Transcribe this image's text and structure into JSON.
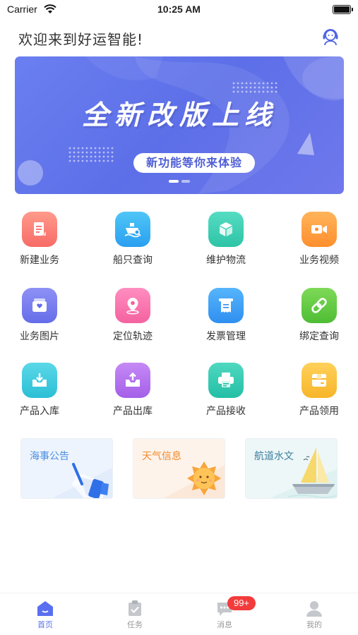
{
  "status_bar": {
    "carrier": "Carrier",
    "time": "10:25 AM"
  },
  "header": {
    "welcome": "欢迎来到好运智能!",
    "service_icon": "customer-service-icon"
  },
  "banner": {
    "title": "全新改版上线",
    "subtitle": "新功能等你来体验",
    "dot_count": 2,
    "active_dot": 0,
    "background": "#6577ee"
  },
  "grid": [
    {
      "label": "新建业务",
      "icon": "document-icon",
      "color_top": "#ff9a8b",
      "color_bottom": "#f76b67"
    },
    {
      "label": "船只查询",
      "icon": "ship-search-icon",
      "color_top": "#4fc6f7",
      "color_bottom": "#2a9ff0"
    },
    {
      "label": "维护物流",
      "icon": "box-icon",
      "color_top": "#55dcc3",
      "color_bottom": "#2ec4a6"
    },
    {
      "label": "业务视频",
      "icon": "video-icon",
      "color_top": "#ffb45a",
      "color_bottom": "#ff8f2e"
    },
    {
      "label": "业务图片",
      "icon": "image-icon",
      "color_top": "#8d91f5",
      "color_bottom": "#666de9"
    },
    {
      "label": "定位轨迹",
      "icon": "location-pin-icon",
      "color_top": "#ff8dc0",
      "color_bottom": "#f4629f"
    },
    {
      "label": "发票管理",
      "icon": "invoice-icon",
      "color_top": "#56b5fb",
      "color_bottom": "#2f8ff0"
    },
    {
      "label": "绑定查询",
      "icon": "link-icon",
      "color_top": "#7ed957",
      "color_bottom": "#4ebd34"
    },
    {
      "label": "产品入库",
      "icon": "inbox-in-icon",
      "color_top": "#5ad8e8",
      "color_bottom": "#2cbfd6"
    },
    {
      "label": "产品出库",
      "icon": "inbox-out-icon",
      "color_top": "#c58af5",
      "color_bottom": "#a45fe8"
    },
    {
      "label": "产品接收",
      "icon": "printer-receive-icon",
      "color_top": "#4fd8c0",
      "color_bottom": "#23bfa6"
    },
    {
      "label": "产品领用",
      "icon": "package-icon",
      "color_top": "#ffd15a",
      "color_bottom": "#f7b52a"
    }
  ],
  "cards": [
    {
      "title": "海事公告",
      "icon": "megaphone-icon",
      "title_color": "#4a8fe0",
      "bg": "#eef4fd"
    },
    {
      "title": "天气信息",
      "icon": "sun-icon",
      "title_color": "#f08a2c",
      "bg": "#fdf3ea"
    },
    {
      "title": "航道水文",
      "icon": "sailboat-icon",
      "title_color": "#3d7f9e",
      "bg": "#edf7f7"
    }
  ],
  "tab_bar": {
    "tabs": [
      {
        "label": "首页",
        "icon": "home-icon",
        "active": true
      },
      {
        "label": "任务",
        "icon": "clipboard-check-icon",
        "active": false
      },
      {
        "label": "消息",
        "icon": "chat-bubble-icon",
        "active": false,
        "badge": "99+"
      },
      {
        "label": "我的",
        "icon": "user-icon",
        "active": false
      }
    ],
    "active_color": "#5a6ff0",
    "inactive_color": "#c4c7cc"
  }
}
